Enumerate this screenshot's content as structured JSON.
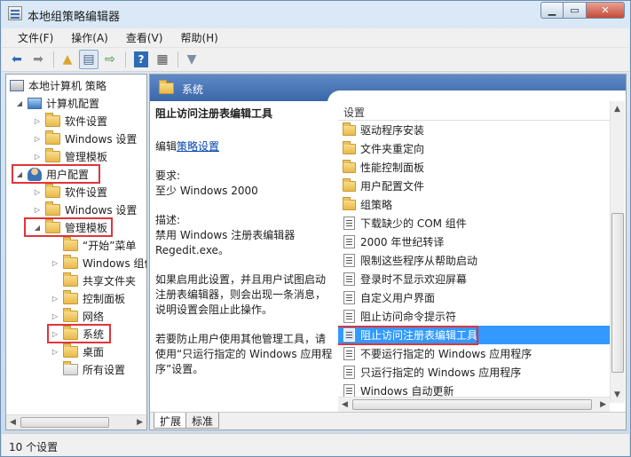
{
  "window": {
    "title": "本地组策略编辑器"
  },
  "menu": [
    "文件(F)",
    "操作(A)",
    "查看(V)",
    "帮助(H)"
  ],
  "toolbar_icons": [
    "back-arrow-icon",
    "forward-arrow-icon",
    "up-folder-icon",
    "show-hide-tree-icon",
    "export-list-icon",
    "help-icon",
    "properties-icon",
    "filter-icon"
  ],
  "tree": {
    "items": [
      {
        "label": "本地计算机 策略"
      },
      {
        "label": "计算机配置"
      },
      {
        "label": "软件设置"
      },
      {
        "label": "Windows 设置"
      },
      {
        "label": "管理模板"
      },
      {
        "label": "用户配置"
      },
      {
        "label": "软件设置"
      },
      {
        "label": "Windows 设置"
      },
      {
        "label": "管理模板"
      },
      {
        "label": "“开始”菜单"
      },
      {
        "label": "Windows 组件"
      },
      {
        "label": "共享文件夹"
      },
      {
        "label": "控制面板"
      },
      {
        "label": "网络"
      },
      {
        "label": "系统"
      },
      {
        "label": "桌面"
      },
      {
        "label": "所有设置"
      }
    ]
  },
  "pane": {
    "header": "系统",
    "desc_title": "阻止访问注册表编辑工具",
    "edit_prefix": "编辑",
    "edit_link": "策略设置",
    "req_label": "要求:",
    "req_value": "至少 Windows 2000",
    "desc_label": "描述:",
    "desc_line1": "禁用 Windows 注册表编辑器",
    "desc_line2": "Regedit.exe。",
    "desc_para2": "如果启用此设置，并且用户试图启动注册表编辑器，则会出现一条消息，说明设置会阻止此操作。",
    "desc_para3": "若要防止用户使用其他管理工具，请使用“只运行指定的 Windows 应用程序”设置。",
    "list_header": "设置",
    "list": [
      {
        "label": "驱动程序安装",
        "kind": "folder"
      },
      {
        "label": "文件夹重定向",
        "kind": "folder"
      },
      {
        "label": "性能控制面板",
        "kind": "folder"
      },
      {
        "label": "用户配置文件",
        "kind": "folder"
      },
      {
        "label": "组策略",
        "kind": "folder"
      },
      {
        "label": "下载缺少的 COM 组件",
        "kind": "setting"
      },
      {
        "label": "2000 年世纪转译",
        "kind": "setting"
      },
      {
        "label": "限制这些程序从帮助启动",
        "kind": "setting"
      },
      {
        "label": "登录时不显示欢迎屏幕",
        "kind": "setting"
      },
      {
        "label": "自定义用户界面",
        "kind": "setting"
      },
      {
        "label": "阻止访问命令提示符",
        "kind": "setting"
      },
      {
        "label": "阻止访问注册表编辑工具",
        "kind": "setting",
        "selected": true
      },
      {
        "label": "不要运行指定的 Windows 应用程序",
        "kind": "setting"
      },
      {
        "label": "只运行指定的 Windows 应用程序",
        "kind": "setting"
      },
      {
        "label": "Windows 自动更新",
        "kind": "setting"
      }
    ],
    "tabs": [
      "扩展",
      "标准"
    ]
  },
  "status": "10 个设置",
  "highlight_color": "#e0343a",
  "selection_color": "#3399ff"
}
